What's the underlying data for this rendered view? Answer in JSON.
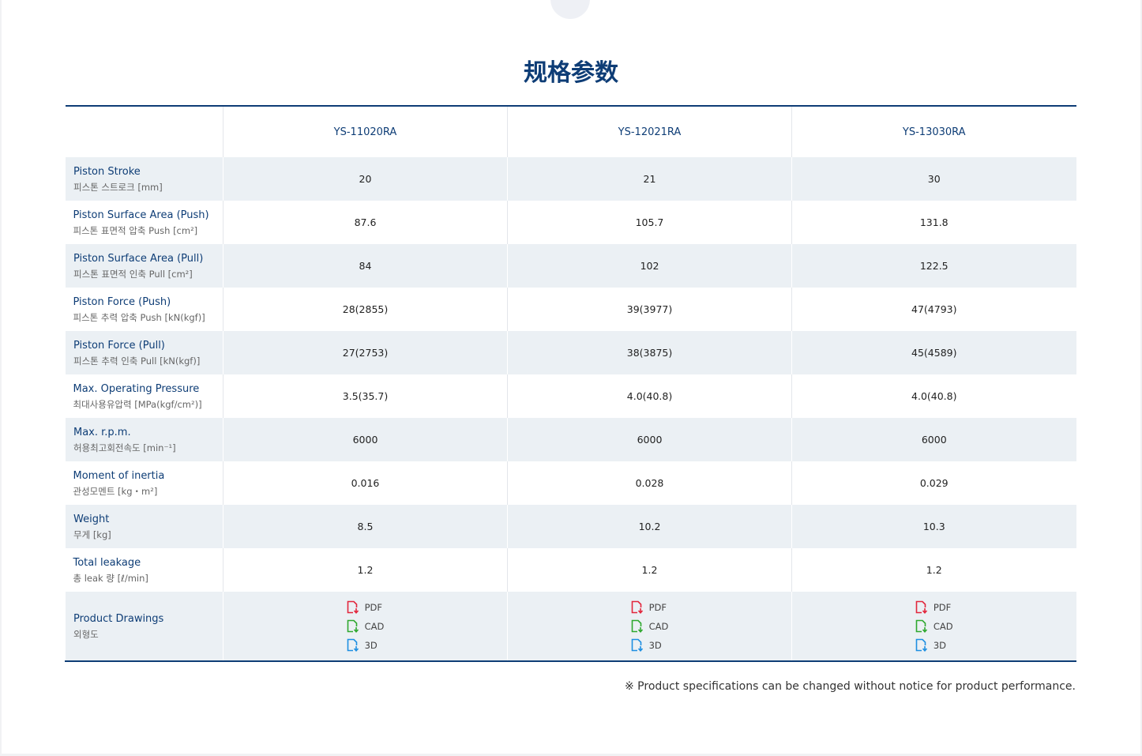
{
  "title": "规格参数",
  "columns": [
    "",
    "YS-11020RA",
    "YS-12021RA",
    "YS-13030RA"
  ],
  "rows": [
    {
      "label_en": "Piston Stroke",
      "label_ko": "피스톤 스트로크 [mm]",
      "values": [
        "20",
        "21",
        "30"
      ]
    },
    {
      "label_en": "Piston Surface Area (Push)",
      "label_ko": "피스톤 표면적 압축 Push [cm²]",
      "values": [
        "87.6",
        "105.7",
        "131.8"
      ]
    },
    {
      "label_en": "Piston Surface Area (Pull)",
      "label_ko": "피스톤 표면적 인축 Pull [cm²]",
      "values": [
        "84",
        "102",
        "122.5"
      ]
    },
    {
      "label_en": "Piston Force (Push)",
      "label_ko": "피스톤 추력 압축 Push [kN(kgf)]",
      "values": [
        "28(2855)",
        "39(3977)",
        "47(4793)"
      ]
    },
    {
      "label_en": "Piston Force (Pull)",
      "label_ko": "피스톤 추력 인축 Pull [kN(kgf)]",
      "values": [
        "27(2753)",
        "38(3875)",
        "45(4589)"
      ]
    },
    {
      "label_en": "Max. Operating Pressure",
      "label_ko": "최대사용유압력 [MPa(kgf/cm²)]",
      "values": [
        "3.5(35.7)",
        "4.0(40.8)",
        "4.0(40.8)"
      ]
    },
    {
      "label_en": "Max. r.p.m.",
      "label_ko": "허용최고회전속도 [min⁻¹]",
      "values": [
        "6000",
        "6000",
        "6000"
      ]
    },
    {
      "label_en": "Moment of inertia",
      "label_ko": "관성모멘트 [kg・m²]",
      "values": [
        "0.016",
        "0.028",
        "0.029"
      ]
    },
    {
      "label_en": "Weight",
      "label_ko": "무게 [kg]",
      "values": [
        "8.5",
        "10.2",
        "10.3"
      ]
    },
    {
      "label_en": "Total leakage",
      "label_ko": "총 leak 량 [ℓ/min]",
      "values": [
        "1.2",
        "1.2",
        "1.2"
      ]
    }
  ],
  "drawings": {
    "label_en": "Product Drawings",
    "label_ko": "외형도",
    "links": [
      {
        "label": "PDF",
        "icon": "pdf-file-icon",
        "color": "#e2263c"
      },
      {
        "label": "CAD",
        "icon": "cad-file-icon",
        "color": "#2fa82f"
      },
      {
        "label": "3D",
        "icon": "3d-file-icon",
        "color": "#1e8fe1"
      }
    ]
  },
  "note": "※ Product specifications can be changed without notice for product performance.",
  "colors": {
    "primary": "#0e3d76",
    "row_alt": "#ebf0f4",
    "pdf": "#e2263c",
    "cad": "#2fa82f",
    "threed": "#1e8fe1"
  }
}
